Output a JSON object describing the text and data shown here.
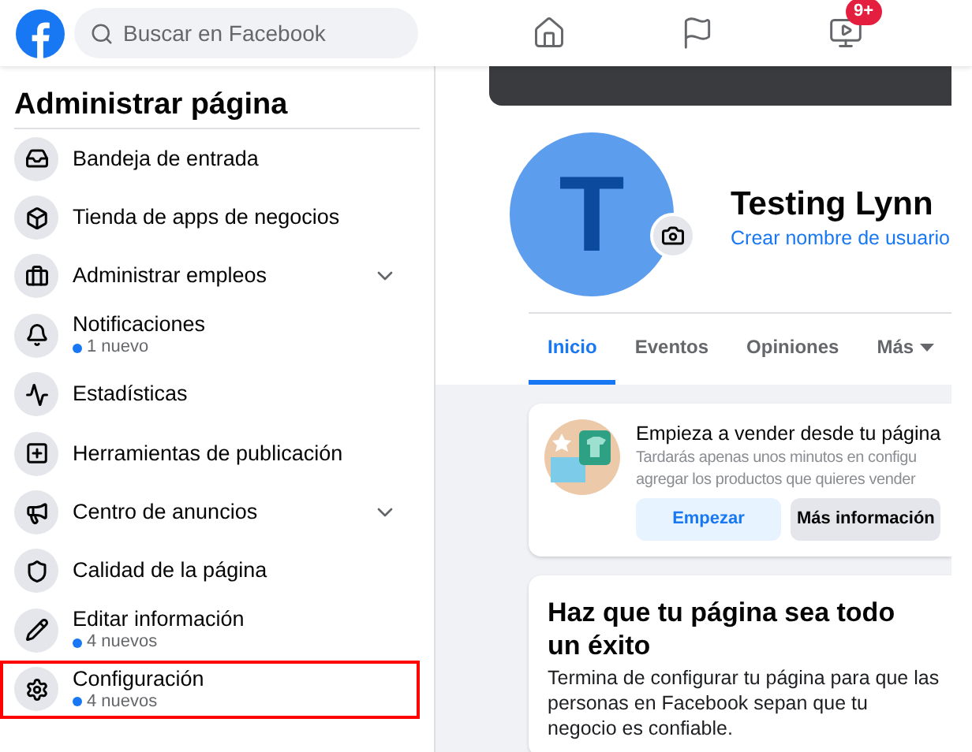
{
  "topbar": {
    "search": {
      "placeholder": "Buscar en Facebook"
    },
    "nav": [
      {
        "kind": "home"
      },
      {
        "kind": "flag"
      },
      {
        "kind": "video",
        "badge": "9+"
      }
    ]
  },
  "sidebar": {
    "title": "Administrar página",
    "items": [
      {
        "kind": "inbox",
        "label": "Bandeja de entrada",
        "expandable": false,
        "highlighted": false
      },
      {
        "kind": "box",
        "label": "Tienda de apps de negocios",
        "expandable": false,
        "highlighted": false
      },
      {
        "kind": "briefcase",
        "label": "Administrar empleos",
        "expandable": true,
        "highlighted": false
      },
      {
        "kind": "bell",
        "label": "Notificaciones",
        "sub": "1 nuevo",
        "expandable": false,
        "highlighted": false
      },
      {
        "kind": "chart",
        "label": "Estadísticas",
        "expandable": false,
        "highlighted": false
      },
      {
        "kind": "tools",
        "label": "Herramientas de publicación",
        "expandable": false,
        "highlighted": false
      },
      {
        "kind": "megaphone",
        "label": "Centro de anuncios",
        "expandable": true,
        "highlighted": false
      },
      {
        "kind": "shield",
        "label": "Calidad de la página",
        "expandable": false,
        "highlighted": false
      },
      {
        "kind": "pencil",
        "label": "Editar información",
        "sub": "4 nuevos",
        "expandable": false,
        "highlighted": false
      },
      {
        "kind": "gear",
        "label": "Configuración",
        "sub": "4 nuevos",
        "expandable": false,
        "highlighted": true
      }
    ]
  },
  "profile": {
    "avatar_letter": "T",
    "name": "Testing Lynn",
    "username_link": "Crear nombre de usuario",
    "tabs": [
      {
        "label": "Inicio",
        "selected": true,
        "kind": "link"
      },
      {
        "label": "Eventos",
        "selected": false,
        "kind": "link"
      },
      {
        "label": "Opiniones",
        "selected": false,
        "kind": "link"
      },
      {
        "label": "Más",
        "selected": false,
        "kind": "menu"
      }
    ]
  },
  "shop_card": {
    "title": "Empieza a vender desde tu página",
    "text_lines": [
      "Tardarás apenas unos minutos en configu",
      "agregar los productos que quieres vender"
    ],
    "buttons": [
      {
        "label": "Empezar",
        "kind": "primary"
      },
      {
        "label": "Más información",
        "kind": "secondary"
      }
    ]
  },
  "success_card": {
    "title": "Haz que tu página sea todo un éxito",
    "text": "Termina de configurar tu página para que las personas en Facebook sepan que tu negocio es confiable."
  }
}
